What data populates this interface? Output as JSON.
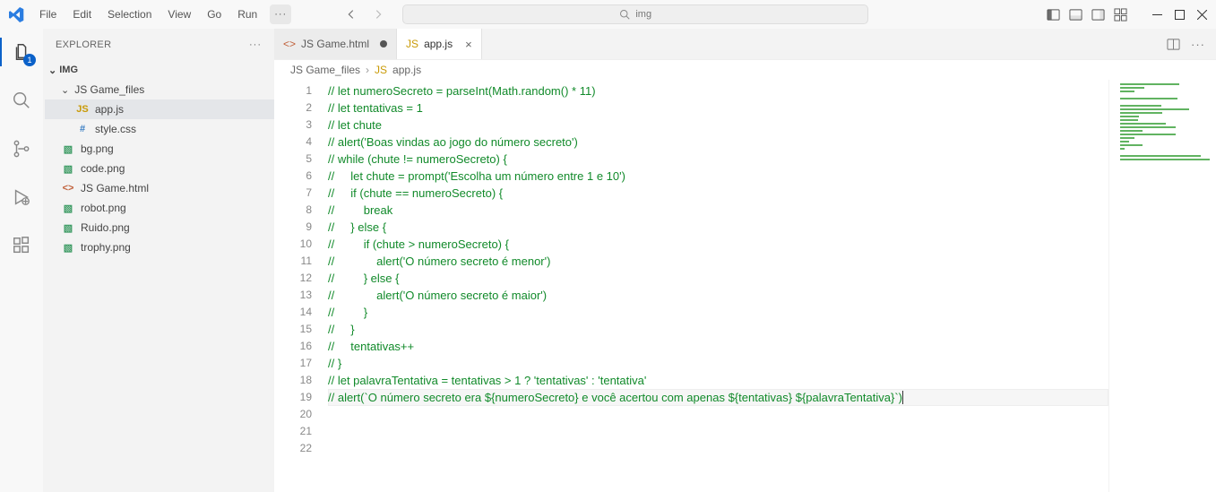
{
  "menu": {
    "file": "File",
    "edit": "Edit",
    "selection": "Selection",
    "view": "View",
    "go": "Go",
    "run": "Run"
  },
  "search": {
    "text": "img"
  },
  "explorer": {
    "title": "EXPLORER",
    "root": "IMG",
    "folder": "JS Game_files",
    "files": [
      {
        "icon": "js",
        "name": "app.js"
      },
      {
        "icon": "css",
        "name": "style.css"
      },
      {
        "icon": "img",
        "name": "bg.png"
      },
      {
        "icon": "img",
        "name": "code.png"
      },
      {
        "icon": "html",
        "name": "JS Game.html"
      },
      {
        "icon": "img",
        "name": "robot.png"
      },
      {
        "icon": "img",
        "name": "Ruido.png"
      },
      {
        "icon": "img",
        "name": "trophy.png"
      }
    ],
    "badge": "1"
  },
  "tabs": [
    {
      "icon": "html",
      "label": "JS Game.html",
      "dirty": true,
      "active": false
    },
    {
      "icon": "js",
      "label": "app.js",
      "dirty": false,
      "active": true
    }
  ],
  "crumbs": [
    "JS Game_files",
    "app.js"
  ],
  "code": {
    "lines": [
      "// let numeroSecreto = parseInt(Math.random() * 11)",
      "// let tentativas = 1",
      "// let chute",
      "",
      "// alert('Boas vindas ao jogo do número secreto')",
      "",
      "// while (chute != numeroSecreto) {",
      "//     let chute = prompt('Escolha um número entre 1 e 10')",
      "//     if (chute == numeroSecreto) {",
      "//         break",
      "//     } else {",
      "//         if (chute > numeroSecreto) {",
      "//             alert('O número secreto é menor')",
      "//         } else {",
      "//             alert('O número secreto é maior')",
      "//         }",
      "//     }",
      "//     tentativas++",
      "// }",
      "",
      "// let palavraTentativa = tentativas > 1 ? 'tentativas' : 'tentativa'",
      "// alert(`O número secreto era ${numeroSecreto} e você acertou com apenas ${tentativas} ${palavraTentativa}`)"
    ],
    "activeLine": 22
  },
  "icons": {
    "JS": "JS",
    "CSS": "#",
    "IMG": "▧",
    "HTML": "<>"
  }
}
